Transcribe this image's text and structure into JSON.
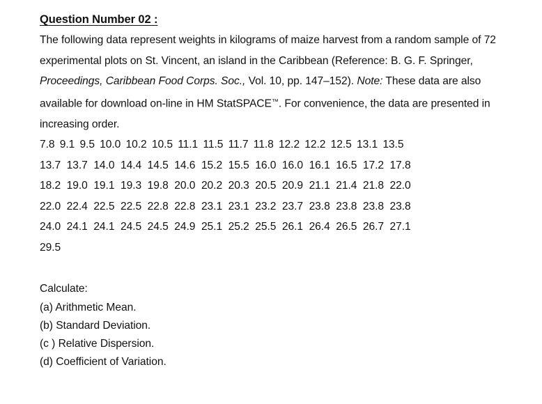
{
  "document": {
    "title": "Question Number 02 :",
    "intro": {
      "segment_1": "The following data represent weights in kilograms of maize harvest from a random sample of 72 experimental plots on St. Vincent, an island in the Caribbean (Reference: B. G. F. Springer, ",
      "italic_1": "Proceedings, Caribbean Food Corps. Soc.,",
      "segment_2": " Vol. 10, pp. 147–152). ",
      "italic_2": "Note:",
      "segment_3": " These data are also available for download on-line in HM StatSPACE",
      "trademark": "™",
      "segment_4": ". For convenience, the data are presented in increasing order."
    },
    "data_rows": [
      [
        "7.8",
        "9.1",
        "9.5",
        "10.0",
        "10.2",
        "10.5",
        "11.1",
        "11.5",
        "11.7",
        "11.8",
        "12.2",
        "12.2",
        "12.5",
        "13.1",
        "13.5"
      ],
      [
        "13.7",
        "13.7",
        "14.0",
        "14.4",
        "14.5",
        "14.6",
        "15.2",
        "15.5",
        "16.0",
        "16.0",
        "16.1",
        "16.5",
        "17.2",
        "17.8"
      ],
      [
        "18.2",
        "19.0",
        "19.1",
        "19.3",
        "19.8",
        "20.0",
        "20.2",
        "20.3",
        "20.5",
        "20.9",
        "21.1",
        "21.4",
        "21.8",
        "22.0"
      ],
      [
        "22.0",
        "22.4",
        "22.5",
        "22.5",
        "22.8",
        "22.8",
        "23.1",
        "23.1",
        "23.2",
        "23.7",
        "23.8",
        "23.8",
        "23.8",
        "23.8"
      ],
      [
        "24.0",
        "24.1",
        "24.1",
        "24.5",
        "24.5",
        "24.9",
        "25.1",
        "25.2",
        "25.5",
        "26.1",
        "26.4",
        "26.5",
        "26.7",
        "27.1"
      ],
      [
        "29.5"
      ]
    ],
    "sample_size": 72,
    "calculate_label": "Calculate:",
    "calculate_items": [
      "(a) Arithmetic Mean.",
      "(b) Standard Deviation.",
      "(c ) Relative Dispersion.",
      "(d) Coefficient of Variation."
    ]
  }
}
